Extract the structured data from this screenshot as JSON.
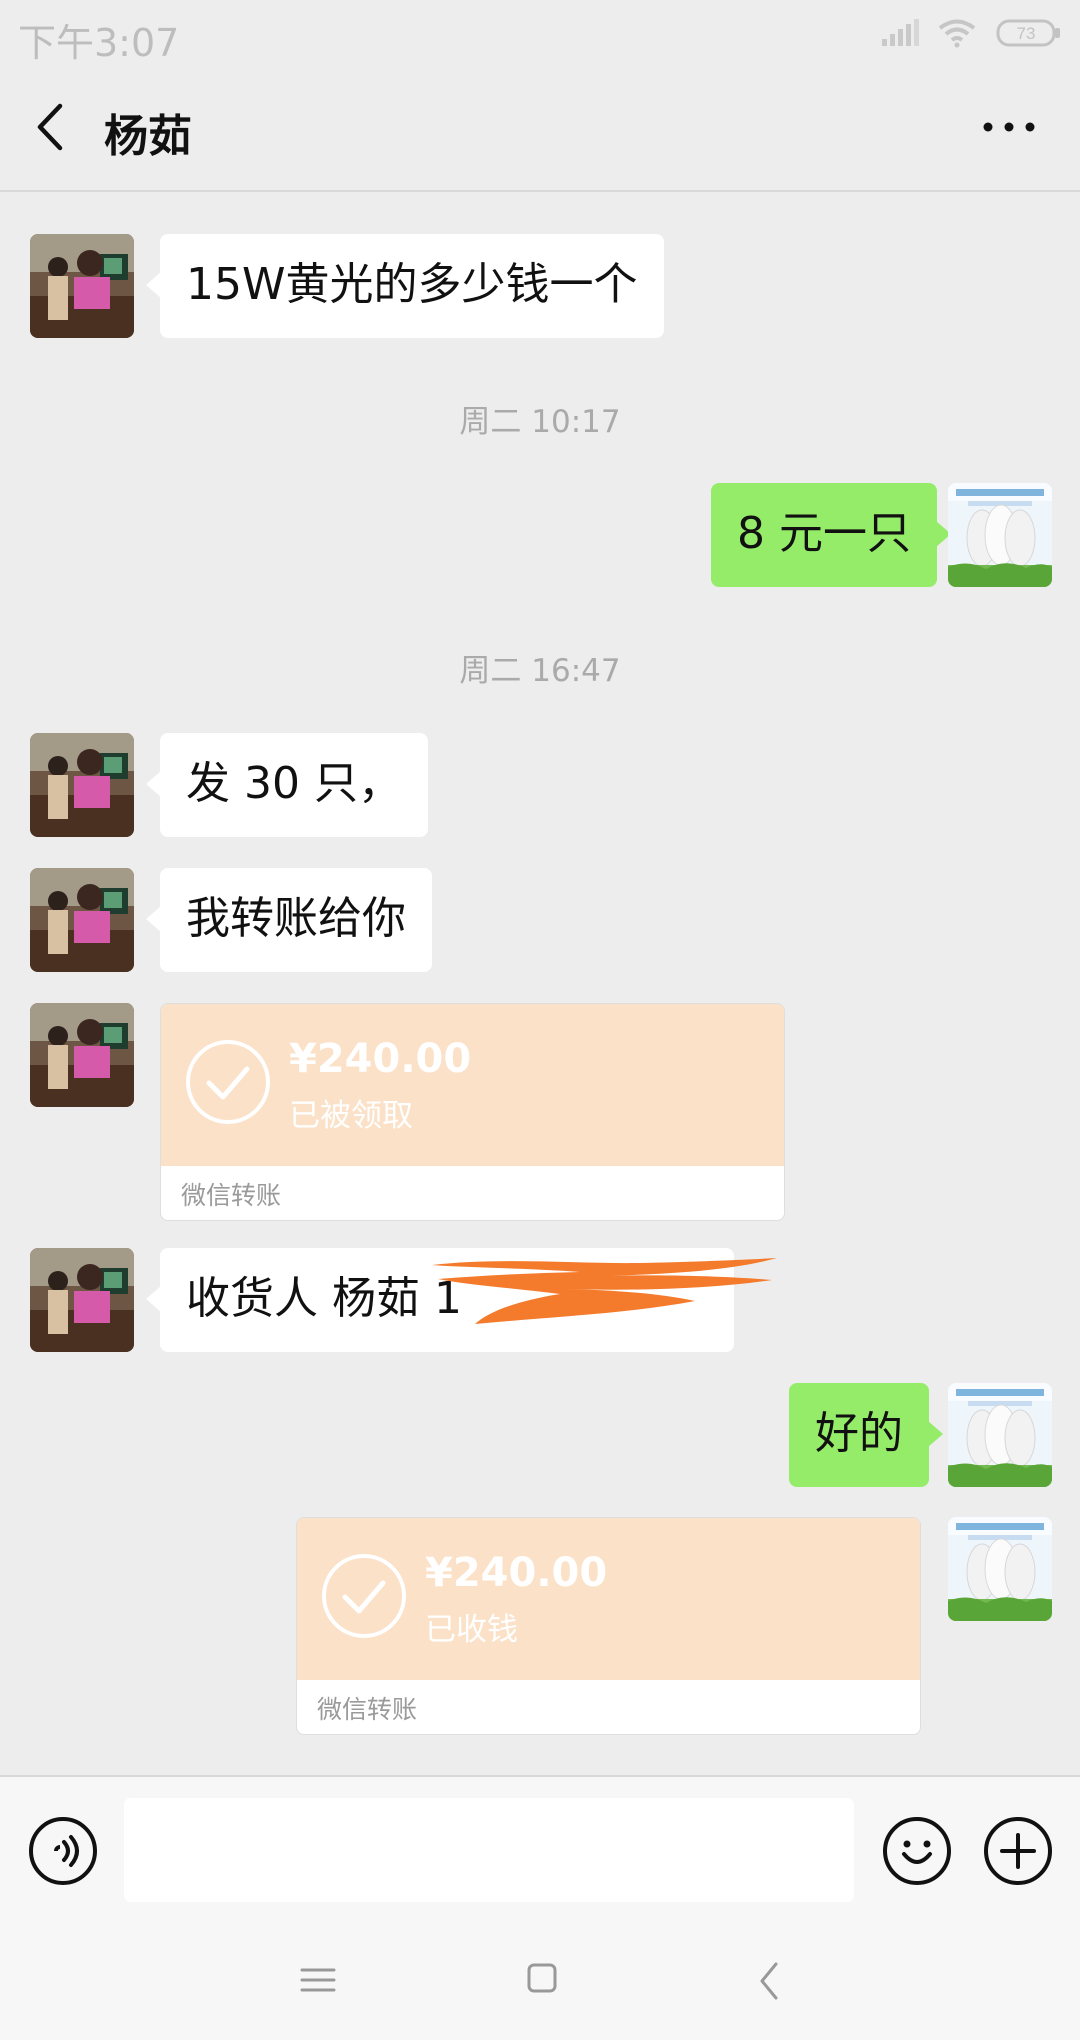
{
  "status_bar": {
    "time": "下午3:07",
    "battery": "73",
    "icons": [
      "signal-icon",
      "wifi-icon",
      "battery-icon"
    ]
  },
  "header": {
    "back_icon": "chevron-left-icon",
    "title": "杨茹",
    "more_icon": "more-dots-icon"
  },
  "messages": [
    {
      "type": "text",
      "side": "left",
      "text": "15W黄光的多少钱一个"
    },
    {
      "type": "time",
      "text": "周二 10:17"
    },
    {
      "type": "text",
      "side": "right",
      "text": "8 元一只"
    },
    {
      "type": "time",
      "text": "周二 16:47"
    },
    {
      "type": "text",
      "side": "left",
      "text": "发 30 只，"
    },
    {
      "type": "text",
      "side": "left",
      "text": "我转账给你"
    },
    {
      "type": "transfer",
      "side": "left",
      "amount": "¥240.00",
      "status": "已被领取",
      "label": "微信转账"
    },
    {
      "type": "text",
      "side": "left",
      "text": "收货人 杨茹 1"
    },
    {
      "type": "text",
      "side": "right",
      "text": "好的"
    },
    {
      "type": "transfer",
      "side": "right",
      "amount": "¥240.00",
      "status": "已收钱",
      "label": "微信转账"
    }
  ],
  "input_bar": {
    "voice_icon": "voice-icon",
    "input_value": "",
    "emoji_icon": "emoji-icon",
    "add_icon": "plus-circle-icon"
  },
  "system_nav": {
    "icons": [
      "menu-icon",
      "home-square-icon",
      "back-arrow-icon"
    ]
  },
  "colors": {
    "background": "#ededed",
    "sent_bubble": "#95ec69",
    "received_bubble": "#ffffff",
    "transfer_card": "#fbe1c8",
    "redaction": "#f47a2c"
  }
}
